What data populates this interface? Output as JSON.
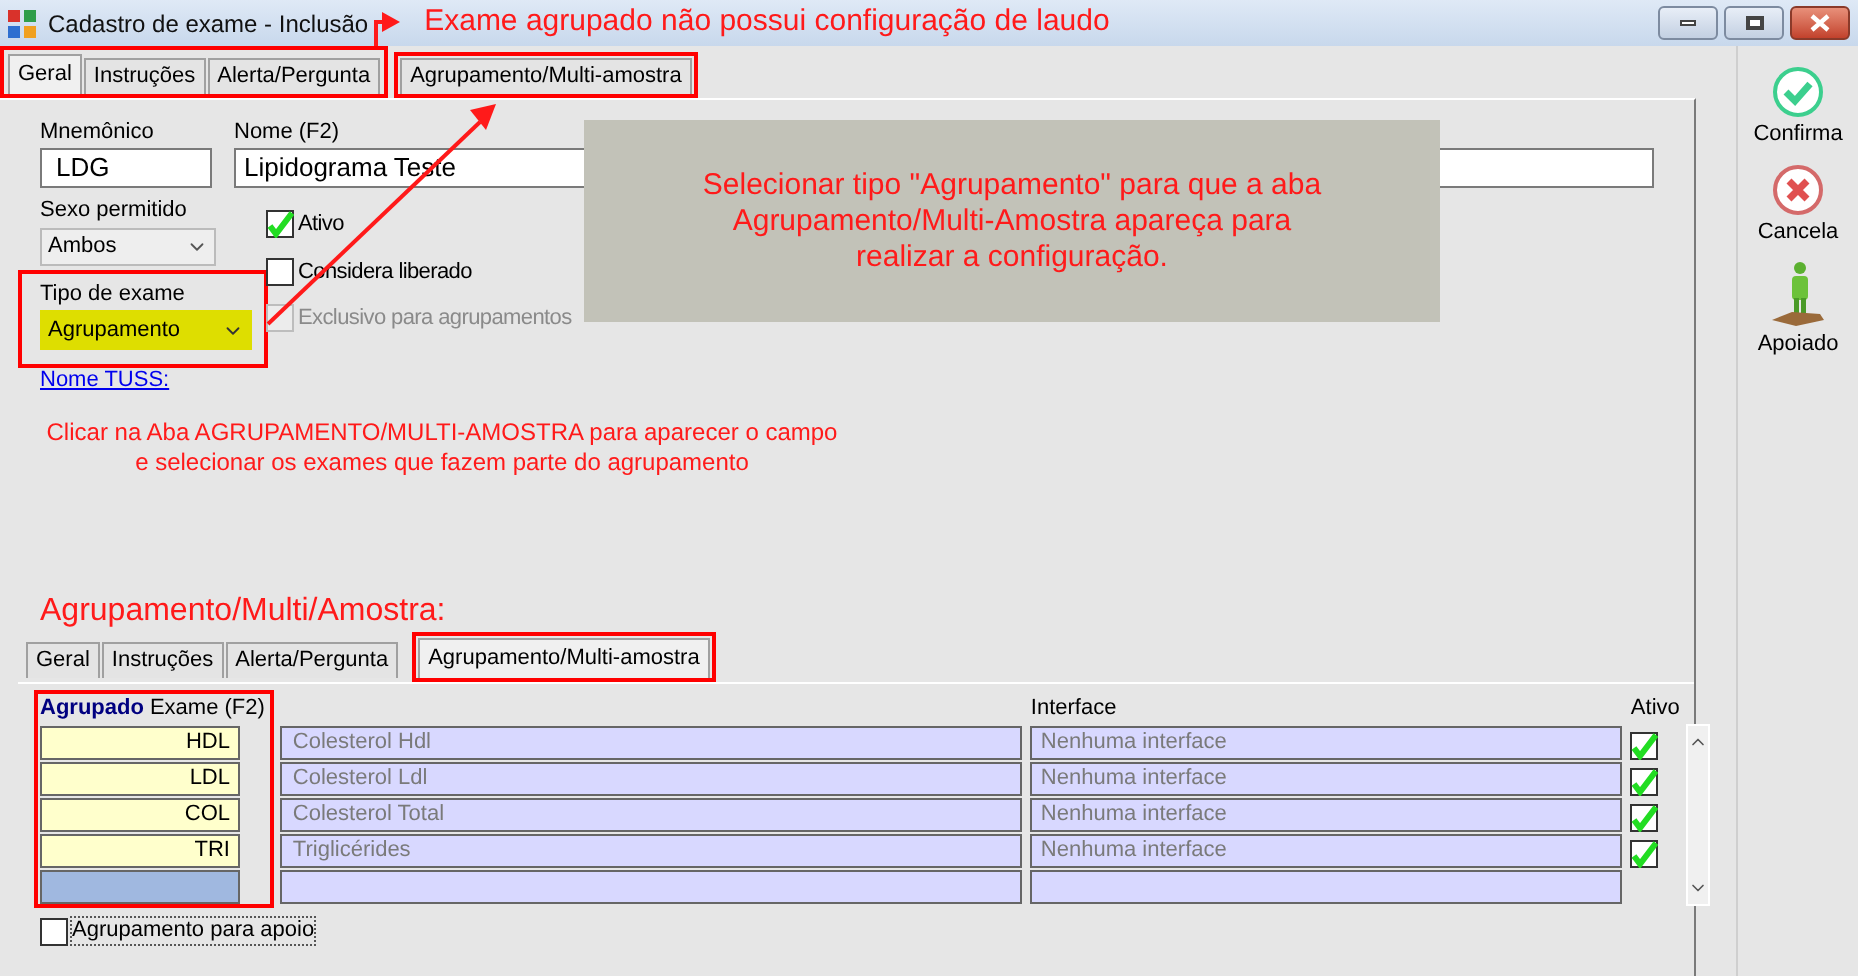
{
  "window": {
    "title": "Cadastro de exame - Inclusão",
    "annotation": "Exame agrupado não possui configuração de laudo"
  },
  "tabs": [
    {
      "label": "Geral",
      "selected": true
    },
    {
      "label": "Instruções",
      "selected": false
    },
    {
      "label": "Alerta/Pergunta",
      "selected": false
    },
    {
      "label": "Agrupamento/Multi-amostra",
      "selected": false
    }
  ],
  "form": {
    "mnemonic": {
      "label": "Mnemônico",
      "value": "LDG"
    },
    "name": {
      "label": "Nome (F2)",
      "value": "Lipidograma Teste"
    },
    "sex": {
      "label": "Sexo permitido",
      "value": "Ambos"
    },
    "type": {
      "label": "Tipo de exame",
      "value": "Agrupamento"
    },
    "link": "Nome TUSS:",
    "checkboxes": [
      {
        "label": "Ativo",
        "checked": true,
        "disabled": false
      },
      {
        "label": "Considera liberado",
        "checked": false,
        "disabled": false
      },
      {
        "label": "Exclusivo para agrupamentos",
        "checked": false,
        "disabled": true
      }
    ]
  },
  "note_box": "Selecionar tipo \"Agrupamento\" para que a aba Agrupamento/Multi-Amostra apareça para realizar a configuração.",
  "instruction": [
    "Clicar na Aba AGRUPAMENTO/MULTI-AMOSTRA para aparecer o campo",
    "e selecionar os exames que fazem parte do agrupamento"
  ],
  "section_title": "Agrupamento/Multi/Amostra:",
  "lower_tabs": [
    {
      "label": "Geral",
      "selected": false
    },
    {
      "label": "Instruções",
      "selected": false
    },
    {
      "label": "Alerta/Pergunta",
      "selected": false
    },
    {
      "label": "Agrupamento/Multi-amostra",
      "selected": true
    }
  ],
  "grid": {
    "column_1": {
      "emphasis": "Agrupado",
      "label": "Exame (F2)"
    },
    "interface_label": "Interface",
    "active_label": "Ativo",
    "rows": [
      {
        "code": "HDL",
        "name": "Colesterol Hdl",
        "interface": "Nenhuma interface",
        "active": true
      },
      {
        "code": "LDL",
        "name": "Colesterol Ldl",
        "interface": "Nenhuma interface",
        "active": true
      },
      {
        "code": "COL",
        "name": "Colesterol Total",
        "interface": "Nenhuma interface",
        "active": true
      },
      {
        "code": "TRI",
        "name": "Triglicérides",
        "interface": "Nenhuma interface",
        "active": true
      }
    ]
  },
  "apoio_checkbox": {
    "label": "Agrupamento para apoio",
    "checked": false
  },
  "toolbar": [
    {
      "label": "Confirma",
      "kind": "confirm"
    },
    {
      "label": "Cancela",
      "kind": "cancel"
    },
    {
      "label": "Apoiado",
      "kind": "person"
    }
  ]
}
